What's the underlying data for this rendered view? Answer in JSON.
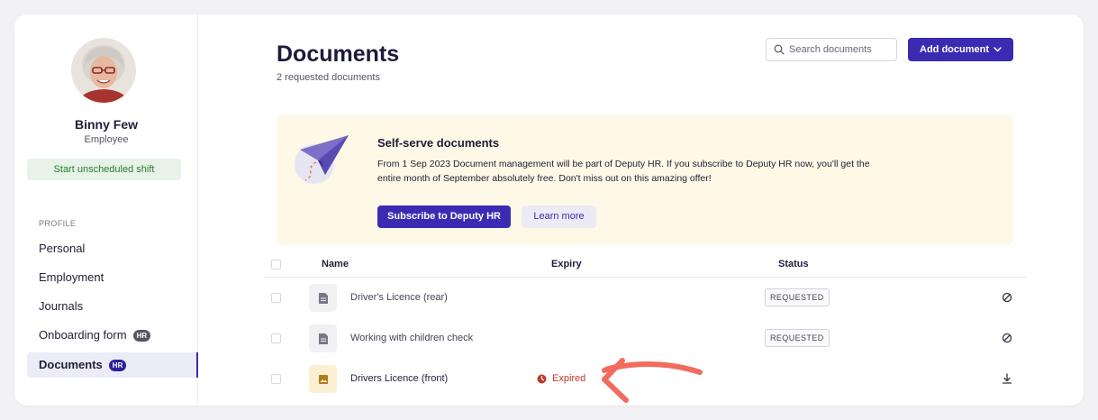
{
  "profile": {
    "name": "Binny Few",
    "role": "Employee",
    "shift_button": "Start unscheduled shift"
  },
  "sidebar": {
    "section_label": "PROFILE",
    "items": [
      {
        "label": "Personal"
      },
      {
        "label": "Employment"
      },
      {
        "label": "Journals"
      },
      {
        "label": "Onboarding form",
        "badge": "HR"
      },
      {
        "label": "Documents",
        "badge": "HR",
        "active": true
      }
    ]
  },
  "header": {
    "title": "Documents",
    "subtitle": "2 requested documents",
    "search_placeholder": "Search documents",
    "add_button": "Add document"
  },
  "banner": {
    "title": "Self-serve documents",
    "body": "From 1 Sep 2023 Document management will be part of Deputy HR. If you subscribe to Deputy HR now, you'll get the entire month of September absolutely free. Don't miss out on this amazing offer!",
    "primary_button": "Subscribe to Deputy HR",
    "secondary_button": "Learn more"
  },
  "table": {
    "columns": [
      "Name",
      "Expiry",
      "Status"
    ],
    "rows": [
      {
        "name": "Driver's Licence (rear)",
        "expiry": "",
        "status": "REQUESTED",
        "icon": "document-icon",
        "action": "block-icon"
      },
      {
        "name": "Working with children check",
        "expiry": "",
        "status": "REQUESTED",
        "icon": "document-icon",
        "action": "block-icon"
      },
      {
        "name": "Drivers Licence (front)",
        "expiry": "Expired",
        "status": "",
        "icon": "image-icon",
        "action": "download-icon"
      }
    ]
  },
  "colors": {
    "accent": "#3b2bb3",
    "expired": "#c0392b",
    "banner_bg": "#fef8e6",
    "arrow": "#f26b5f"
  }
}
